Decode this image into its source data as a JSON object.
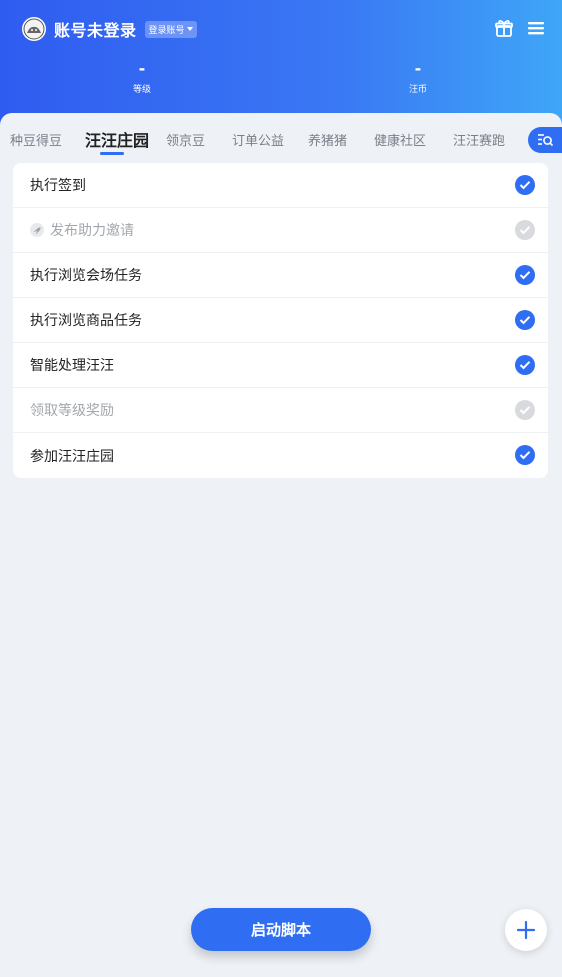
{
  "header": {
    "account_name": "账号未登录",
    "login_badge": "登录账号",
    "stats": [
      {
        "value": "-",
        "label": "等级"
      },
      {
        "value": "-",
        "label": "汪币"
      }
    ]
  },
  "tabs": [
    {
      "label": "种豆得豆",
      "active": false
    },
    {
      "label": "汪汪庄园",
      "active": true
    },
    {
      "label": "领京豆",
      "active": false
    },
    {
      "label": "订单公益",
      "active": false
    },
    {
      "label": "养猪猪",
      "active": false
    },
    {
      "label": "健康社区",
      "active": false
    },
    {
      "label": "汪汪赛跑",
      "active": false
    }
  ],
  "tasks": [
    {
      "label": "执行签到",
      "checked": true,
      "disabled": false
    },
    {
      "label": "发布助力邀请",
      "checked": true,
      "disabled": true
    },
    {
      "label": "执行浏览会场任务",
      "checked": true,
      "disabled": false
    },
    {
      "label": "执行浏览商品任务",
      "checked": true,
      "disabled": false
    },
    {
      "label": "智能处理汪汪",
      "checked": true,
      "disabled": false
    },
    {
      "label": "领取等级奖励",
      "checked": true,
      "disabled": true
    },
    {
      "label": "参加汪汪庄园",
      "checked": true,
      "disabled": false
    }
  ],
  "start_button_label": "启动脚本",
  "colors": {
    "accent": "#2f6df2",
    "header_start": "#2f5cf0",
    "header_end": "#3ea6f7"
  }
}
